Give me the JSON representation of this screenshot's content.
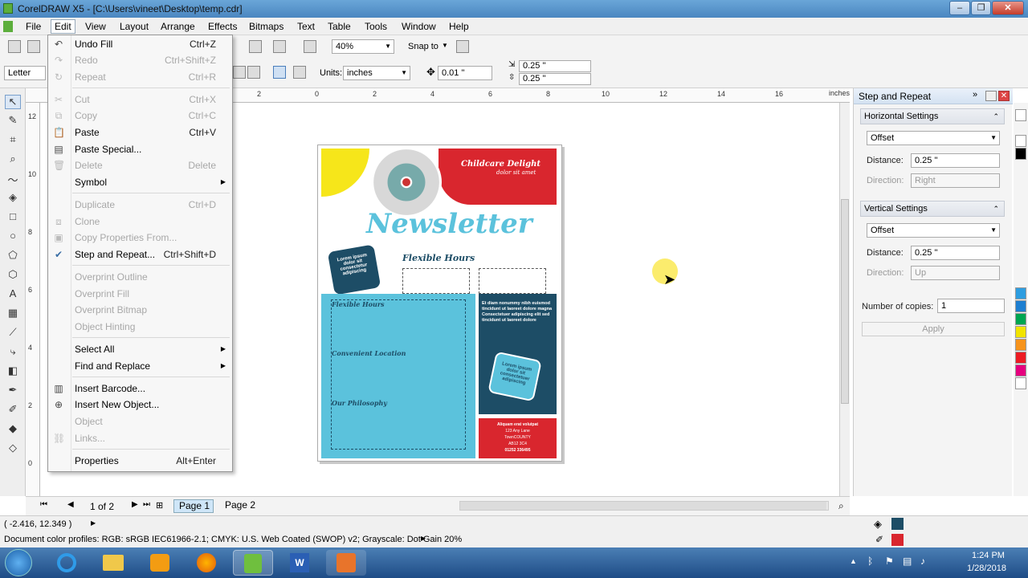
{
  "window": {
    "title": "CorelDRAW X5 - [C:\\Users\\vineet\\Desktop\\temp.cdr]",
    "min": "–",
    "max": "❐",
    "close": "✕"
  },
  "menubar": [
    "File",
    "Edit",
    "View",
    "Layout",
    "Arrange",
    "Effects",
    "Bitmaps",
    "Text",
    "Table",
    "Tools",
    "Window",
    "Help"
  ],
  "toolbar": {
    "zoom": "40%",
    "snap": "Snap to"
  },
  "property_bar": {
    "paper": "Letter",
    "units_label": "Units:",
    "units": "inches",
    "nudge": "0.01 \"",
    "dup_x": "0.25 \"",
    "dup_y": "0.25 \""
  },
  "ruler_top": [
    "2",
    "0",
    "2",
    "4",
    "6",
    "8",
    "10",
    "12",
    "14",
    "16"
  ],
  "ruler_unit": "inches",
  "ruler_left": [
    "12",
    "10",
    "8",
    "6",
    "4",
    "2",
    "0"
  ],
  "edit_menu": [
    {
      "label": "Undo Fill",
      "shortcut": "Ctrl+Z",
      "icon": "undo-icon",
      "disabled": false
    },
    {
      "label": "Redo",
      "shortcut": "Ctrl+Shift+Z",
      "icon": "redo-icon",
      "disabled": true
    },
    {
      "label": "Repeat",
      "shortcut": "Ctrl+R",
      "icon": "repeat-icon",
      "disabled": true
    },
    {
      "sep": true
    },
    {
      "label": "Cut",
      "shortcut": "Ctrl+X",
      "icon": "cut-icon",
      "disabled": true
    },
    {
      "label": "Copy",
      "shortcut": "Ctrl+C",
      "icon": "copy-icon",
      "disabled": true
    },
    {
      "label": "Paste",
      "shortcut": "Ctrl+V",
      "icon": "paste-icon",
      "disabled": false
    },
    {
      "label": "Paste Special...",
      "shortcut": "",
      "icon": "paste-special-icon",
      "disabled": false
    },
    {
      "label": "Delete",
      "shortcut": "Delete",
      "icon": "delete-icon",
      "disabled": true
    },
    {
      "label": "Symbol",
      "shortcut": "",
      "icon": "",
      "disabled": false,
      "submenu": true
    },
    {
      "sep": true
    },
    {
      "label": "Duplicate",
      "shortcut": "Ctrl+D",
      "icon": "",
      "disabled": true
    },
    {
      "label": "Clone",
      "shortcut": "",
      "icon": "clone-icon",
      "disabled": true
    },
    {
      "label": "Copy Properties From...",
      "shortcut": "",
      "icon": "copy-properties-icon",
      "disabled": true
    },
    {
      "label": "Step and Repeat...",
      "shortcut": "Ctrl+Shift+D",
      "icon": "check-icon",
      "disabled": false
    },
    {
      "sep": true
    },
    {
      "label": "Overprint Outline",
      "shortcut": "",
      "icon": "",
      "disabled": true
    },
    {
      "label": "Overprint Fill",
      "shortcut": "",
      "icon": "",
      "disabled": true
    },
    {
      "label": "Overprint Bitmap",
      "shortcut": "",
      "icon": "",
      "disabled": true
    },
    {
      "label": "Object Hinting",
      "shortcut": "",
      "icon": "",
      "disabled": true
    },
    {
      "sep": true
    },
    {
      "label": "Select All",
      "shortcut": "",
      "icon": "",
      "disabled": false,
      "submenu": true
    },
    {
      "label": "Find and Replace",
      "shortcut": "",
      "icon": "",
      "disabled": false,
      "submenu": true
    },
    {
      "sep": true
    },
    {
      "label": "Insert Barcode...",
      "shortcut": "",
      "icon": "barcode-icon",
      "disabled": false
    },
    {
      "label": "Insert New Object...",
      "shortcut": "",
      "icon": "insert-object-icon",
      "disabled": false
    },
    {
      "label": "Object",
      "shortcut": "",
      "icon": "",
      "disabled": true
    },
    {
      "label": "Links...",
      "shortcut": "",
      "icon": "links-icon",
      "disabled": true
    },
    {
      "sep": true
    },
    {
      "label": "Properties",
      "shortcut": "Alt+Enter",
      "icon": "",
      "disabled": false
    }
  ],
  "docker": {
    "title": "Step and Repeat",
    "horizontal": {
      "header": "Horizontal Settings",
      "mode": "Offset",
      "distance_label": "Distance:",
      "distance": "0.25 \"",
      "direction_label": "Direction:",
      "direction": "Right"
    },
    "vertical": {
      "header": "Vertical Settings",
      "mode": "Offset",
      "distance_label": "Distance:",
      "distance": "0.25 \"",
      "direction_label": "Direction:",
      "direction": "Up"
    },
    "copies_label": "Number of copies:",
    "copies": "1",
    "apply": "Apply"
  },
  "newsletter": {
    "brand": "Childcare Delight",
    "brand_sub": "dolor sit amet",
    "title": "Newsletter",
    "heading1": "Flexible Hours",
    "heading2": "Flexible Hours",
    "heading3": "Convenient Location",
    "heading4": "Our Philosophy",
    "tag1": "Lorem ipsum dolor sit consectetur adipiscing",
    "tag2": "Lorem ipsum dolor sit consectetuer adipiscing",
    "side_text": "Et diam nonummy nibh euismod tincidunt ut laoreet dolore magna Consectetuer adipiscing elit sed tincidunt ut laoreet dolore",
    "address1": "Aliquam erat volutpat",
    "address2": "123 Any Lane",
    "address3": "TownCOUNTY",
    "address4": "AB12 3C4",
    "phone": "01252 336495"
  },
  "page_nav": {
    "count": "1 of 2",
    "tabs": [
      "Page 1",
      "Page 2"
    ]
  },
  "status": {
    "coords": "( -2.416, 12.349 )",
    "profiles": "Document color profiles: RGB: sRGB IEC61966-2.1; CMYK: U.S. Web Coated (SWOP) v2; Grayscale: Dot Gain 20%"
  },
  "clock": {
    "time": "1:24 PM",
    "date": "1/28/2018"
  },
  "colors": {
    "cyan": "#5bc2dc",
    "navy": "#1d4d66",
    "red": "#d9262e",
    "yellow": "#f6e61a"
  },
  "palette": [
    "#ffffff",
    "#000000",
    "#ffffff",
    "#2e9de0",
    "#1e7fd1",
    "#00a651",
    "#f2e400",
    "#f7941d",
    "#ed1c24",
    "#e5007e",
    "#ffffff"
  ]
}
